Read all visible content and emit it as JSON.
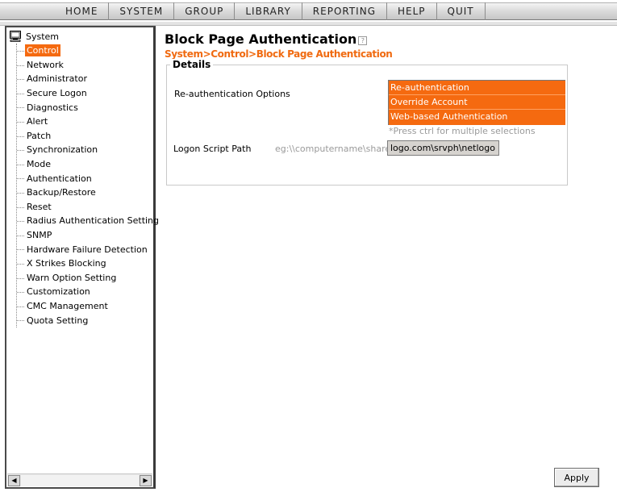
{
  "nav": {
    "items": [
      {
        "label": "HOME"
      },
      {
        "label": "SYSTEM"
      },
      {
        "label": "GROUP"
      },
      {
        "label": "LIBRARY"
      },
      {
        "label": "REPORTING"
      },
      {
        "label": "HELP"
      },
      {
        "label": "QUIT"
      }
    ]
  },
  "sidebar": {
    "root": {
      "label": "System",
      "icon": "computer-icon"
    },
    "selected_index": 0,
    "items": [
      {
        "label": "Control"
      },
      {
        "label": "Network"
      },
      {
        "label": "Administrator"
      },
      {
        "label": "Secure Logon"
      },
      {
        "label": "Diagnostics"
      },
      {
        "label": "Alert"
      },
      {
        "label": "Patch"
      },
      {
        "label": "Synchronization"
      },
      {
        "label": "Mode"
      },
      {
        "label": "Authentication"
      },
      {
        "label": "Backup/Restore"
      },
      {
        "label": "Reset"
      },
      {
        "label": "Radius Authentication Setting"
      },
      {
        "label": "SNMP"
      },
      {
        "label": "Hardware Failure Detection"
      },
      {
        "label": "X Strikes Blocking"
      },
      {
        "label": "Warn Option Setting"
      },
      {
        "label": "Customization"
      },
      {
        "label": "CMC Management"
      },
      {
        "label": "Quota Setting"
      }
    ]
  },
  "main": {
    "title": "Block Page Authentication",
    "help_icon": "?",
    "breadcrumb": "System>Control>Block Page Authentication",
    "details": {
      "legend": "Details",
      "reauth_label": "Re-authentication Options",
      "reauth_options": [
        {
          "label": "Re-authentication",
          "selected": true
        },
        {
          "label": "Override Account",
          "selected": true
        },
        {
          "label": "Web-based Authentication",
          "selected": true
        }
      ],
      "hint": "*Press ctrl for multiple selections",
      "logon_label": "Logon Script Path",
      "logon_example": "eg:\\\\computername\\sharepath",
      "logon_value": "logo.com\\srvph\\netlogon"
    },
    "apply_label": "Apply"
  },
  "colors": {
    "accent": "#f56a10",
    "breadcrumb": "#f06a10",
    "selected_text": "#ffffff",
    "hint_text": "#9a9a9a"
  }
}
